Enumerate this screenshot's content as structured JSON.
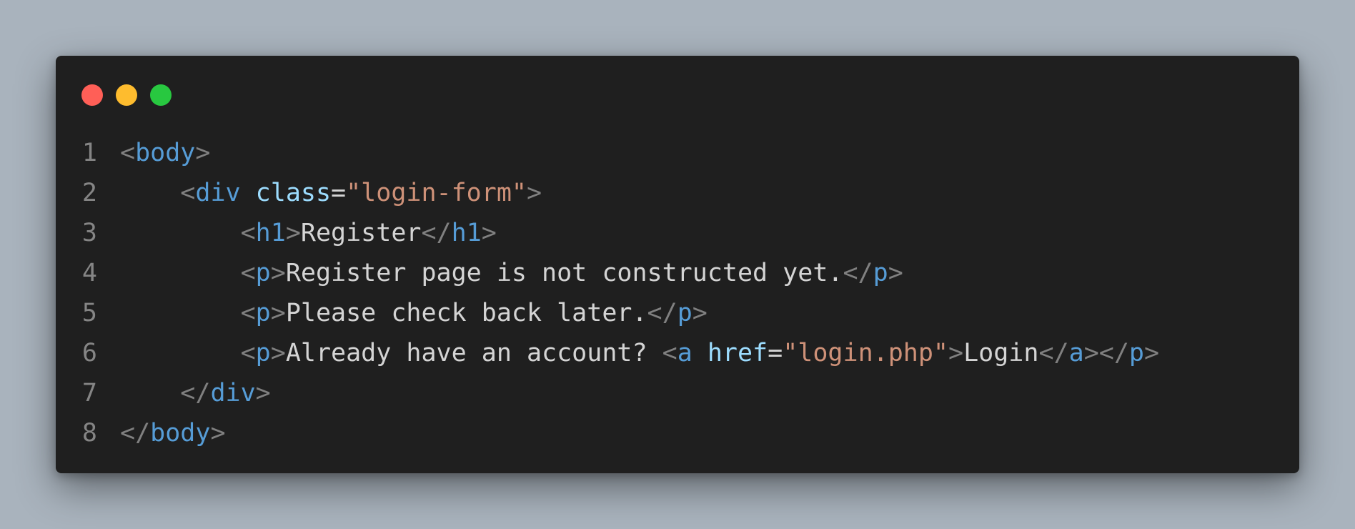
{
  "window": {
    "controls": {
      "close": {
        "icon": "close-dot-icon",
        "color": "#ff5f57"
      },
      "minimize": {
        "icon": "minimize-dot-icon",
        "color": "#febc2e"
      },
      "maximize": {
        "icon": "maximize-dot-icon",
        "color": "#28c840"
      }
    }
  },
  "colors": {
    "tag": "#569cd6",
    "attribute": "#9cdcfe",
    "string": "#ce9178",
    "text": "#d4d4d4",
    "punctuation": "#808080",
    "line_number": "#858585",
    "background": "#1f1f1f"
  },
  "code": {
    "lines": [
      {
        "number": "1",
        "tokens": [
          {
            "t": "punct",
            "v": "<"
          },
          {
            "t": "tag",
            "v": "body"
          },
          {
            "t": "punct",
            "v": ">"
          }
        ]
      },
      {
        "number": "2",
        "tokens": [
          {
            "t": "txt",
            "v": "    "
          },
          {
            "t": "punct",
            "v": "<"
          },
          {
            "t": "tag",
            "v": "div"
          },
          {
            "t": "txt",
            "v": " "
          },
          {
            "t": "attr",
            "v": "class"
          },
          {
            "t": "txt",
            "v": "="
          },
          {
            "t": "str",
            "v": "\"login-form\""
          },
          {
            "t": "punct",
            "v": ">"
          }
        ]
      },
      {
        "number": "3",
        "tokens": [
          {
            "t": "txt",
            "v": "        "
          },
          {
            "t": "punct",
            "v": "<"
          },
          {
            "t": "tag",
            "v": "h1"
          },
          {
            "t": "punct",
            "v": ">"
          },
          {
            "t": "txt",
            "v": "Register"
          },
          {
            "t": "punct",
            "v": "</"
          },
          {
            "t": "tag",
            "v": "h1"
          },
          {
            "t": "punct",
            "v": ">"
          }
        ]
      },
      {
        "number": "4",
        "tokens": [
          {
            "t": "txt",
            "v": "        "
          },
          {
            "t": "punct",
            "v": "<"
          },
          {
            "t": "tag",
            "v": "p"
          },
          {
            "t": "punct",
            "v": ">"
          },
          {
            "t": "txt",
            "v": "Register page is not constructed yet."
          },
          {
            "t": "punct",
            "v": "</"
          },
          {
            "t": "tag",
            "v": "p"
          },
          {
            "t": "punct",
            "v": ">"
          }
        ]
      },
      {
        "number": "5",
        "tokens": [
          {
            "t": "txt",
            "v": "        "
          },
          {
            "t": "punct",
            "v": "<"
          },
          {
            "t": "tag",
            "v": "p"
          },
          {
            "t": "punct",
            "v": ">"
          },
          {
            "t": "txt",
            "v": "Please check back later."
          },
          {
            "t": "punct",
            "v": "</"
          },
          {
            "t": "tag",
            "v": "p"
          },
          {
            "t": "punct",
            "v": ">"
          }
        ]
      },
      {
        "number": "6",
        "tokens": [
          {
            "t": "txt",
            "v": "        "
          },
          {
            "t": "punct",
            "v": "<"
          },
          {
            "t": "tag",
            "v": "p"
          },
          {
            "t": "punct",
            "v": ">"
          },
          {
            "t": "txt",
            "v": "Already have an account? "
          },
          {
            "t": "punct",
            "v": "<"
          },
          {
            "t": "tag",
            "v": "a"
          },
          {
            "t": "txt",
            "v": " "
          },
          {
            "t": "attr",
            "v": "href"
          },
          {
            "t": "txt",
            "v": "="
          },
          {
            "t": "str",
            "v": "\"login.php\""
          },
          {
            "t": "punct",
            "v": ">"
          },
          {
            "t": "txt",
            "v": "Login"
          },
          {
            "t": "punct",
            "v": "</"
          },
          {
            "t": "tag",
            "v": "a"
          },
          {
            "t": "punct",
            "v": ">"
          },
          {
            "t": "punct",
            "v": "</"
          },
          {
            "t": "tag",
            "v": "p"
          },
          {
            "t": "punct",
            "v": ">"
          }
        ]
      },
      {
        "number": "7",
        "tokens": [
          {
            "t": "txt",
            "v": "    "
          },
          {
            "t": "punct",
            "v": "</"
          },
          {
            "t": "tag",
            "v": "div"
          },
          {
            "t": "punct",
            "v": ">"
          }
        ]
      },
      {
        "number": "8",
        "tokens": [
          {
            "t": "punct",
            "v": "</"
          },
          {
            "t": "tag",
            "v": "body"
          },
          {
            "t": "punct",
            "v": ">"
          }
        ]
      }
    ]
  }
}
